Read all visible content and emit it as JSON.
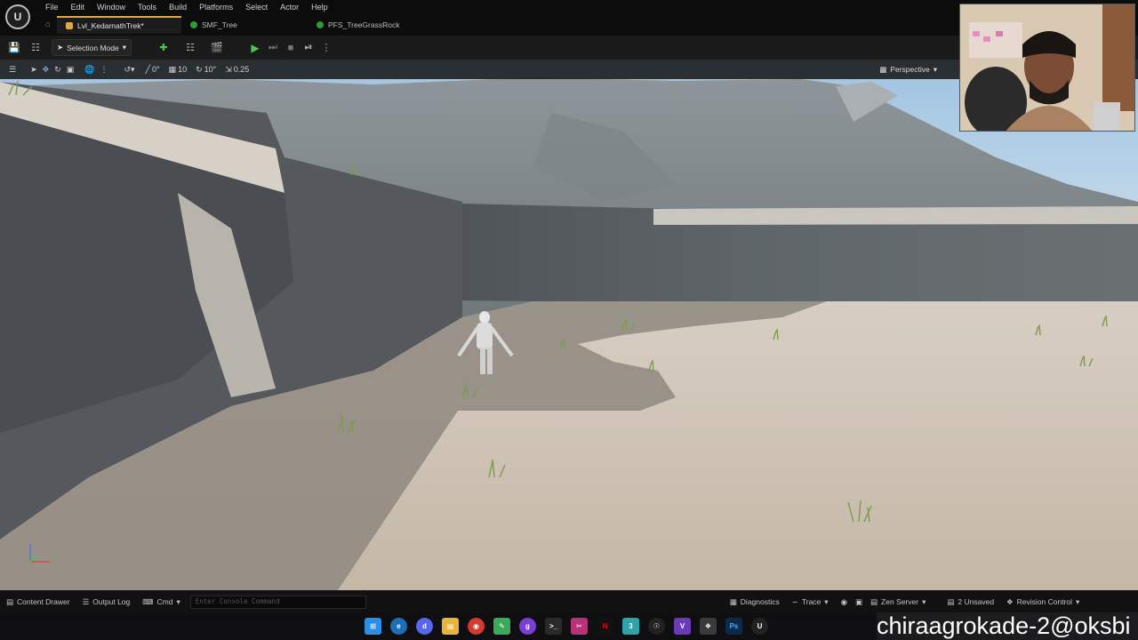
{
  "menu": {
    "items": [
      "File",
      "Edit",
      "Window",
      "Tools",
      "Build",
      "Platforms",
      "Select",
      "Actor",
      "Help"
    ]
  },
  "tabs": [
    {
      "label": "Lvl_KedarnathTrek*",
      "icon": "level-icon",
      "color": "#e3a83b"
    },
    {
      "label": "SMF_Tree",
      "icon": "foliage-icon",
      "color": "#2e9a3a"
    },
    {
      "label": "PFS_TreeGrassRock",
      "icon": "foliage-icon",
      "color": "#2e9a3a"
    }
  ],
  "toolbar": {
    "mode_label": "Selection Mode"
  },
  "viewport_toolbar": {
    "rotation_snap_value": "0°",
    "grid_snap_value": "10",
    "angle_snap_value": "10°",
    "scale_snap_value": "0.25",
    "view_mode_label": "Perspective"
  },
  "statusbar": {
    "content_drawer": "Content Drawer",
    "output_log": "Output Log",
    "cmd": "Cmd",
    "console_placeholder": "Enter Console Command",
    "diagnostics": "Diagnostics",
    "trace": "Trace",
    "zen_server": "Zen Server",
    "unsaved": "2 Unsaved",
    "revision_control": "Revision Control"
  },
  "watermark": "chiraagrokade-2@oksbi",
  "colors": {
    "accent": "#e3a83b",
    "play": "#4fc34f"
  }
}
